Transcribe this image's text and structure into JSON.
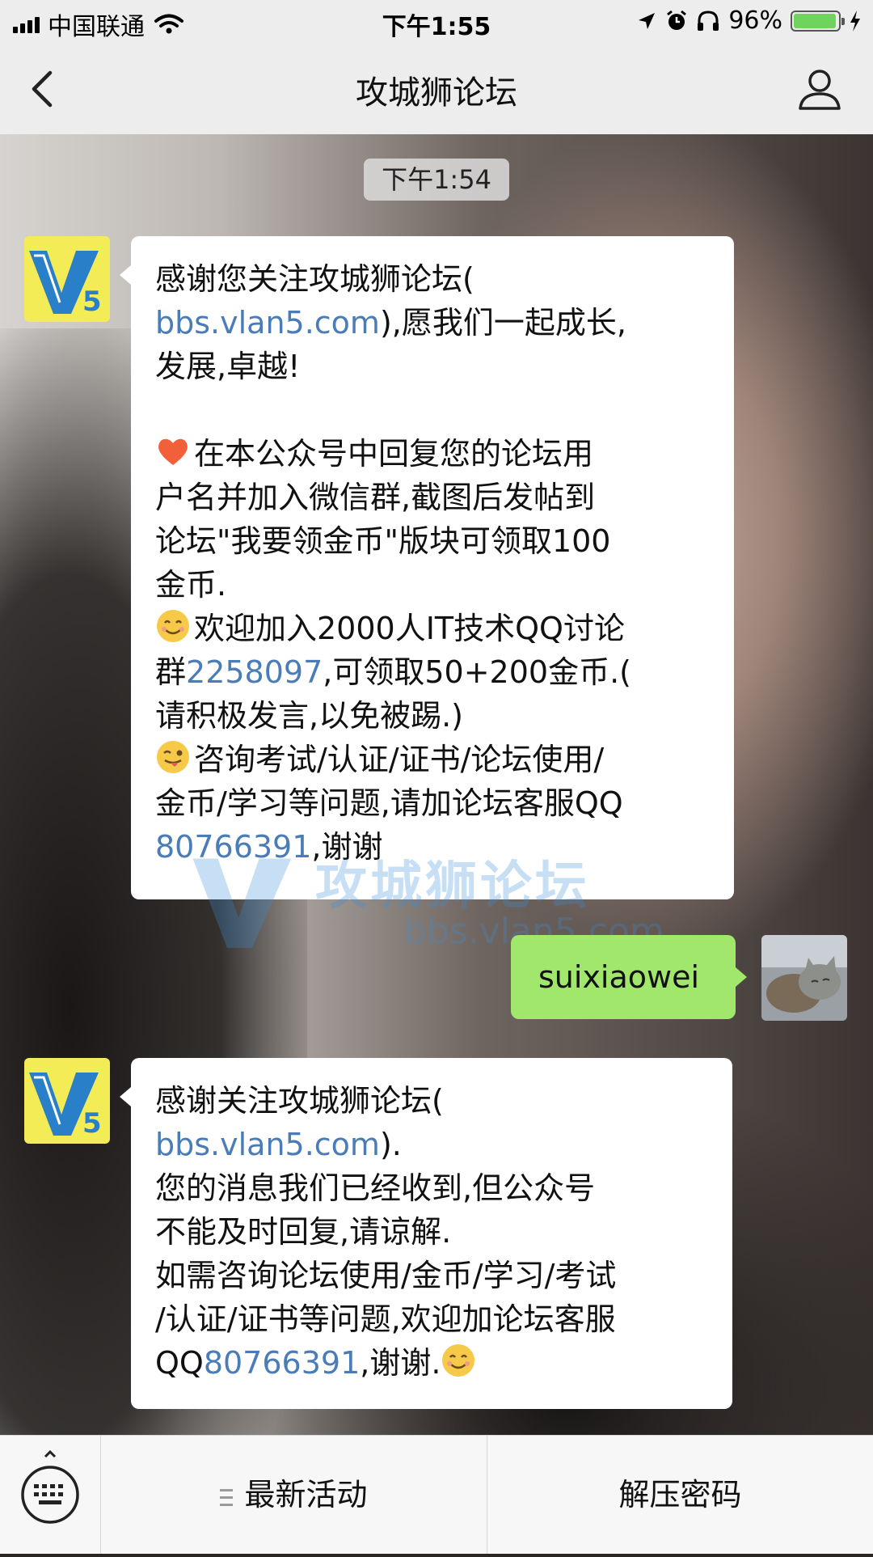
{
  "status_bar": {
    "carrier": "中国联通",
    "time": "下午1:55",
    "battery_percent": "96%",
    "battery_level": 0.96
  },
  "nav": {
    "title": "攻城狮论坛"
  },
  "chat": {
    "time_label": "下午1:54",
    "msg1": {
      "line1": "感谢您关注攻城狮论坛(",
      "link": "bbs.vlan5.com",
      "line2_rest": "),愿我们一起成长,",
      "line3": "发展,卓越!",
      "para2_l1": "在本公众号中回复您的论坛用",
      "para2_l2": "户名并加入微信群,截图后发帖到",
      "para2_l3": "论坛\"我要领金币\"版块可领取100",
      "para2_l4": "金币.",
      "para3_l1": "欢迎加入2000人IT技术QQ讨论",
      "para3_l2_prefix": "群",
      "qq_group": "2258097",
      "para3_l2_rest": ",可领取50+200金币.(",
      "para3_l3": "请积极发言,以免被踢.)",
      "para4_l1": "咨询考试/认证/证书/论坛使用/",
      "para4_l2": "金币/学习等问题,请加论坛客服QQ",
      "qq_service": "80766391",
      "para4_l3_rest": ",谢谢"
    },
    "user_msg": "suixiaowei",
    "msg2": {
      "line1": "感谢关注攻城狮论坛(",
      "link": "bbs.vlan5.com",
      "line2_rest": ").",
      "line3": "您的消息我们已经收到,但公众号",
      "line4": "不能及时回复,请谅解.",
      "line5": "如需咨询论坛使用/金币/学习/考试",
      "line6": "/认证/证书等问题,欢迎加论坛客服",
      "line7_prefix": "QQ",
      "qq_service": "80766391",
      "line7_rest": ",谢谢."
    },
    "watermark": {
      "title": "攻城狮论坛",
      "url": "bbs.vlan5.com"
    }
  },
  "bottom_menu": {
    "item1": "最新活动",
    "item2": "解压密码"
  },
  "colors": {
    "link": "#4a7cb8",
    "sent_bubble": "#a0e76c",
    "battery": "#6fd35d"
  }
}
